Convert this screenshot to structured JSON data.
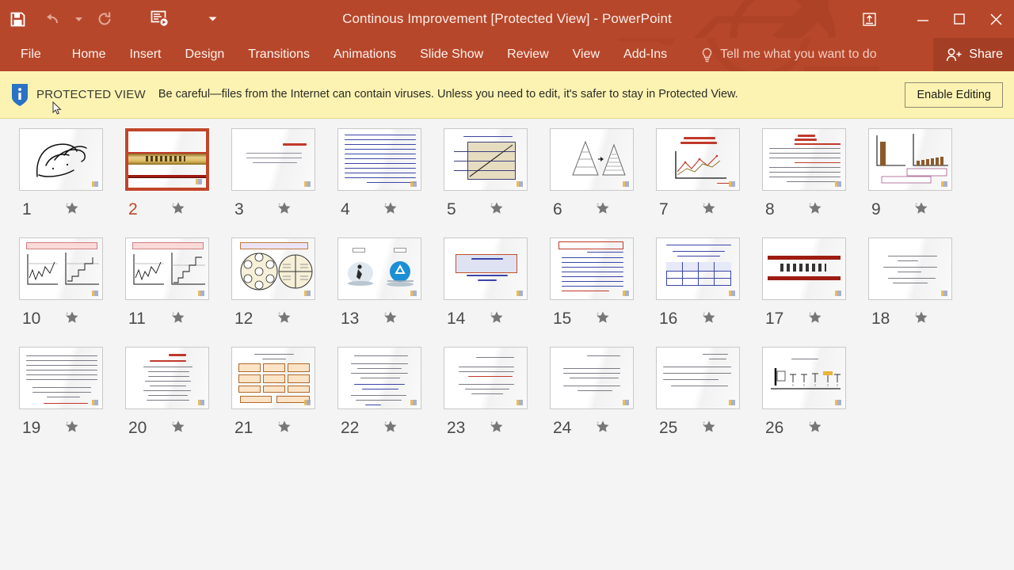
{
  "window": {
    "title": "Continous Improvement [Protected View] - PowerPoint",
    "accent_color": "#b7472a",
    "quick_access": [
      {
        "name": "save-button",
        "icon": "save-icon",
        "enabled": true
      },
      {
        "name": "undo-button",
        "icon": "undo-icon",
        "enabled": false
      },
      {
        "name": "undo-dropdown",
        "icon": "chevron-down-icon",
        "enabled": false
      },
      {
        "name": "redo-button",
        "icon": "redo-icon",
        "enabled": false
      },
      {
        "name": "start-slideshow-button",
        "icon": "slideshow-icon",
        "enabled": true
      },
      {
        "name": "customize-qat-dropdown",
        "icon": "chevron-down-icon",
        "enabled": true
      }
    ],
    "controls": {
      "ribbon_display": "ribbon-display-options-icon",
      "minimize": "minimize-icon",
      "restore": "restore-icon",
      "close": "close-icon"
    }
  },
  "ribbon": {
    "tabs": [
      {
        "label": "File"
      },
      {
        "label": "Home"
      },
      {
        "label": "Insert"
      },
      {
        "label": "Design"
      },
      {
        "label": "Transitions"
      },
      {
        "label": "Animations"
      },
      {
        "label": "Slide Show"
      },
      {
        "label": "Review"
      },
      {
        "label": "View"
      },
      {
        "label": "Add-Ins"
      }
    ],
    "tell_me": "Tell me what you want to do",
    "share": "Share"
  },
  "protected_view": {
    "label": "PROTECTED VIEW",
    "message": "Be careful—files from the Internet can contain viruses. Unless you need to edit, it's safer to stay in Protected View.",
    "button": "Enable Editing",
    "background_color": "#fcf3b2",
    "icon": "info-icon"
  },
  "slide_sorter": {
    "selected_slide": 2,
    "total_slides": 26,
    "columns": 9,
    "slides": [
      {
        "number": "1",
        "art": "calligraphy",
        "starred": true
      },
      {
        "number": "2",
        "art": "gold-banner",
        "starred": true
      },
      {
        "number": "3",
        "art": "short-text",
        "starred": true
      },
      {
        "number": "4",
        "art": "dense-blue-text",
        "starred": true
      },
      {
        "number": "5",
        "art": "tan-table",
        "starred": true
      },
      {
        "number": "6",
        "art": "pyramids",
        "starred": true
      },
      {
        "number": "7",
        "art": "line-chart",
        "starred": true
      },
      {
        "number": "8",
        "art": "red-head-text",
        "starred": true
      },
      {
        "number": "9",
        "art": "bar-charts",
        "starred": true
      },
      {
        "number": "10",
        "art": "dual-step-chart",
        "starred": true
      },
      {
        "number": "11",
        "art": "dual-step-chart",
        "starred": true
      },
      {
        "number": "12",
        "art": "two-circles",
        "starred": true
      },
      {
        "number": "13",
        "art": "two-images",
        "starred": true
      },
      {
        "number": "14",
        "art": "blue-box-title",
        "starred": true
      },
      {
        "number": "15",
        "art": "red-frame-text",
        "starred": true
      },
      {
        "number": "16",
        "art": "blue-table",
        "starred": true
      },
      {
        "number": "17",
        "art": "red-bars-title",
        "starred": true
      },
      {
        "number": "18",
        "art": "short-text",
        "starred": true
      },
      {
        "number": "19",
        "art": "dense-text",
        "starred": true
      },
      {
        "number": "20",
        "art": "bullet-list",
        "starred": true
      },
      {
        "number": "21",
        "art": "orange-boxes",
        "starred": true
      },
      {
        "number": "22",
        "art": "bullet-list",
        "starred": true
      },
      {
        "number": "23",
        "art": "short-text",
        "starred": true
      },
      {
        "number": "24",
        "art": "short-text",
        "starred": true
      },
      {
        "number": "25",
        "art": "short-text",
        "starred": true
      },
      {
        "number": "26",
        "art": "timeline",
        "starred": true
      }
    ]
  }
}
